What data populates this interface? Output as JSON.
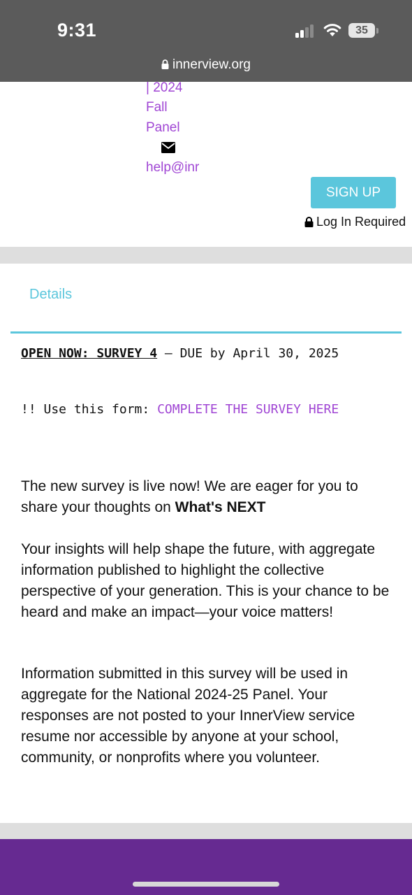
{
  "status_bar": {
    "time": "9:31",
    "battery": "35",
    "url": "innerview.org"
  },
  "header": {
    "nav_lines": [
      "| 2024",
      "Fall",
      "Panel"
    ],
    "email_link": "help@inr",
    "signup_label": "SIGN UP",
    "login_required": "Log In Required"
  },
  "tabs": {
    "details_label": "Details"
  },
  "content": {
    "headline": "OPEN NOW: SURVEY 4",
    "due": " – DUE by April 30, 2025",
    "form_prefix": "!! Use this form: ",
    "form_link": "COMPLETE THE SURVEY HERE",
    "p1_text": "The new survey is live now! We are eager for you to share your thoughts on ",
    "p1_bold": "What's NEXT",
    "p2": "Your insights will help shape the future, with aggregate information published to highlight the collective perspective of your generation. This is your chance to be heard and make an impact—your voice matters!",
    "p3": "Information submitted in this survey will be used in aggregate for the National 2024-25 Panel.  Your responses are not posted to your InnerView service resume nor accessible by anyone at your school, community, or nonprofits where you volunteer."
  },
  "colors": {
    "accent_cyan": "#5bc6dc",
    "link_purple": "#a046d4",
    "footer_purple": "#662a91",
    "chrome_gray": "#5b5b5b"
  }
}
